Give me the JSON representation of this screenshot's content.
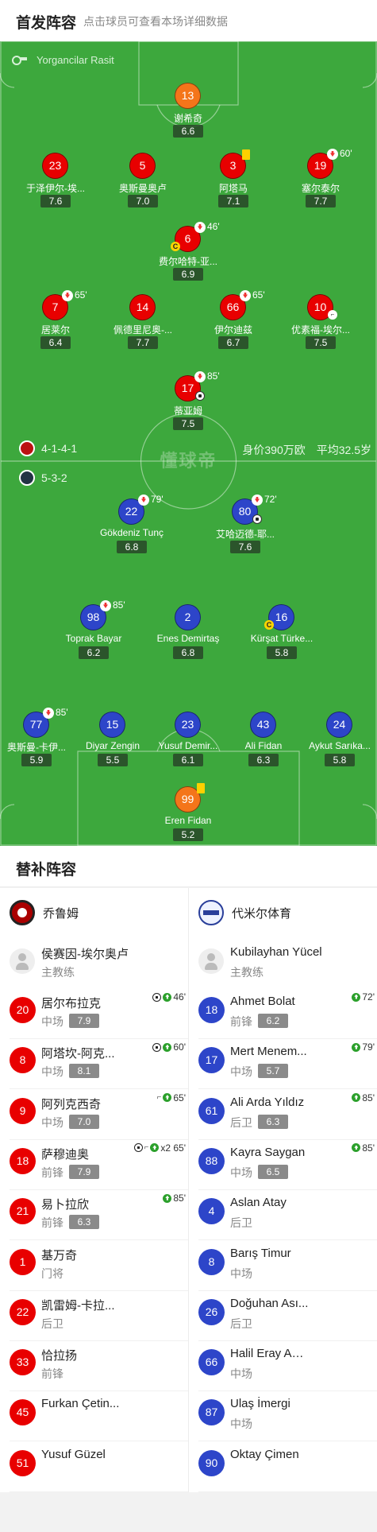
{
  "header": {
    "title": "首发阵容",
    "subtitle": "点击球员可查看本场详细数据"
  },
  "pitch": {
    "referee": "Yorgancilar Rasit",
    "watermark": "懂球帝",
    "home_formation": "4-1-4-1",
    "away_formation": "5-3-2",
    "value": "身价390万欧",
    "avg_age": "平均32.5岁"
  },
  "home_players": [
    {
      "num": "13",
      "name": "谢希奇",
      "rating": "6.6",
      "color": "orange"
    },
    {
      "num": "23",
      "name": "于泽伊尔-埃...",
      "rating": "7.6",
      "color": "red"
    },
    {
      "num": "5",
      "name": "奥斯曼奥卢",
      "rating": "7.0",
      "color": "red"
    },
    {
      "num": "3",
      "name": "阿塔马",
      "rating": "7.1",
      "color": "red",
      "yellow": true
    },
    {
      "num": "19",
      "name": "塞尔泰尔",
      "rating": "7.7",
      "color": "red",
      "out": "60'"
    },
    {
      "num": "6",
      "name": "费尔哈特-亚...",
      "rating": "6.9",
      "color": "red",
      "out": "46'",
      "captain": true
    },
    {
      "num": "7",
      "name": "居莱尔",
      "rating": "6.4",
      "color": "red",
      "out": "65'"
    },
    {
      "num": "14",
      "name": "佩德里尼奥-...",
      "rating": "7.7",
      "color": "red"
    },
    {
      "num": "66",
      "name": "伊尔迪兹",
      "rating": "6.7",
      "color": "red",
      "out": "65'"
    },
    {
      "num": "10",
      "name": "优素福-埃尔...",
      "rating": "7.5",
      "color": "red",
      "boot": true
    },
    {
      "num": "17",
      "name": "蒂亚姆",
      "rating": "7.5",
      "color": "red",
      "out": "85'",
      "ball": true
    }
  ],
  "away_players": [
    {
      "num": "22",
      "name": "Gökdeniz Tunç",
      "rating": "6.8",
      "color": "blue",
      "out": "79'"
    },
    {
      "num": "80",
      "name": "艾哈迈德-耶...",
      "rating": "7.6",
      "color": "blue",
      "out": "72'",
      "ball": true
    },
    {
      "num": "98",
      "name": "Toprak Bayar",
      "rating": "6.2",
      "color": "blue",
      "out": "85'"
    },
    {
      "num": "2",
      "name": "Enes Demirtaş",
      "rating": "6.8",
      "color": "blue"
    },
    {
      "num": "16",
      "name": "Kürşat Türke...",
      "rating": "5.8",
      "color": "blue",
      "captain": true
    },
    {
      "num": "77",
      "name": "奥斯曼-卡伊...",
      "rating": "5.9",
      "color": "blue",
      "out": "85'"
    },
    {
      "num": "15",
      "name": "Diyar Zengin",
      "rating": "5.5",
      "color": "blue"
    },
    {
      "num": "23",
      "name": "Yusuf Demir...",
      "rating": "6.1",
      "color": "blue"
    },
    {
      "num": "43",
      "name": "Ali Fidan",
      "rating": "6.3",
      "color": "blue"
    },
    {
      "num": "24",
      "name": "Aykut Sarıka...",
      "rating": "5.8",
      "color": "blue"
    },
    {
      "num": "99",
      "name": "Eren Fidan",
      "rating": "5.2",
      "color": "orange",
      "yellow": true
    }
  ],
  "subs": {
    "title": "替补阵容",
    "home": {
      "team": "乔鲁姆",
      "coach": {
        "name": "侯赛因-埃尔奥卢",
        "role": "主教练"
      },
      "players": [
        {
          "num": "20",
          "name": "居尔布拉克",
          "pos": "中场",
          "rating": "7.9",
          "events": "46'",
          "ball": true
        },
        {
          "num": "8",
          "name": "阿塔坎-阿克...",
          "pos": "中场",
          "rating": "8.1",
          "events": "60'",
          "ball": true
        },
        {
          "num": "9",
          "name": "阿列克西奇",
          "pos": "中场",
          "rating": "7.0",
          "events": "65'",
          "boot": true
        },
        {
          "num": "18",
          "name": "萨穆迪奥",
          "pos": "前锋",
          "rating": "7.9",
          "events": "x2 65'",
          "ball": true,
          "boot": true
        },
        {
          "num": "21",
          "name": "易卜拉欣",
          "pos": "前锋",
          "rating": "6.3",
          "events": "85'"
        },
        {
          "num": "1",
          "name": "基万奇",
          "pos": "门将"
        },
        {
          "num": "22",
          "name": "凯雷姆-卡拉...",
          "pos": "后卫"
        },
        {
          "num": "33",
          "name": "恰拉扬",
          "pos": "前锋"
        },
        {
          "num": "45",
          "name": "Furkan Çetin...",
          "pos": ""
        },
        {
          "num": "51",
          "name": "Yusuf Güzel",
          "pos": ""
        }
      ]
    },
    "away": {
      "team": "代米尔体育",
      "coach": {
        "name": "Kubilayhan Yücel",
        "role": "主教练"
      },
      "players": [
        {
          "num": "18",
          "name": "Ahmet Bolat",
          "pos": "前锋",
          "rating": "6.2",
          "events": "72'"
        },
        {
          "num": "17",
          "name": "Mert Menem...",
          "pos": "中场",
          "rating": "5.7",
          "events": "79'"
        },
        {
          "num": "61",
          "name": "Ali Arda Yıldız",
          "pos": "后卫",
          "rating": "6.3",
          "events": "85'"
        },
        {
          "num": "88",
          "name": "Kayra Saygan",
          "pos": "中场",
          "rating": "6.5",
          "events": "85'"
        },
        {
          "num": "4",
          "name": "Aslan Atay",
          "pos": "后卫"
        },
        {
          "num": "8",
          "name": "Barış Timur",
          "pos": "中场"
        },
        {
          "num": "26",
          "name": "Doğuhan Ası...",
          "pos": "后卫"
        },
        {
          "num": "66",
          "name": "Halil Eray Aktaş",
          "pos": "中场"
        },
        {
          "num": "87",
          "name": "Ulaş İmergi",
          "pos": "中场"
        },
        {
          "num": "90",
          "name": "Oktay Çimen",
          "pos": ""
        }
      ]
    }
  }
}
